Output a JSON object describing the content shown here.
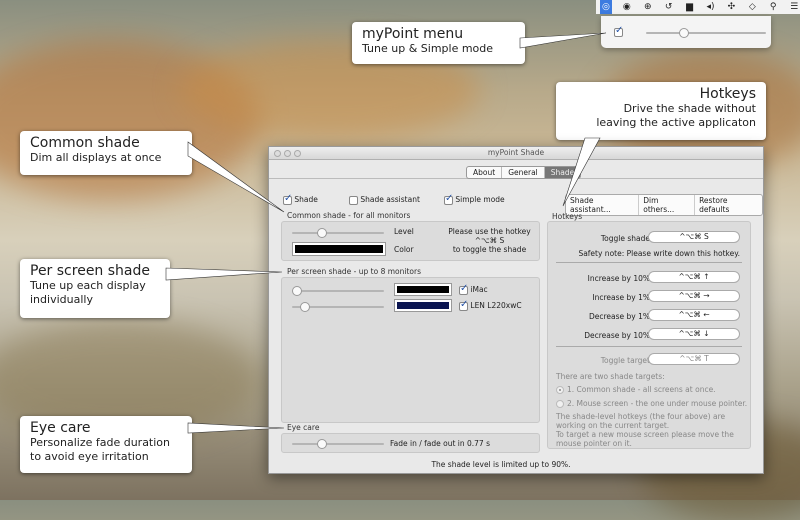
{
  "menubar": {
    "icons": [
      "mypoint-icon",
      "target-icon",
      "accessibility-icon",
      "time-machine-icon",
      "display-icon",
      "volume-icon",
      "move-icon",
      "wifi-icon",
      "spotlight-icon",
      "list-icon"
    ]
  },
  "popup": {
    "enabled": true,
    "level_pct": 30
  },
  "callouts": {
    "menu": {
      "title": "myPoint menu",
      "subtitle": "Tune up & Simple mode"
    },
    "hotkeys": {
      "title": "Hotkeys",
      "line1": "Drive the shade without",
      "line2": "leaving the active applicaton"
    },
    "common": {
      "title": "Common shade",
      "subtitle": "Dim all displays at once"
    },
    "perscreen": {
      "title": "Per screen shade",
      "line1": "Tune up each display",
      "line2": "individually"
    },
    "eyecare": {
      "title": "Eye care",
      "line1": "Personalize fade duration",
      "line2": "to avoid eye irritation"
    }
  },
  "window": {
    "title": "myPoint Shade",
    "tabs": [
      "About",
      "General",
      "Shade"
    ],
    "selected_tab": "Shade",
    "options": {
      "shade": "Shade",
      "shade_checked": true,
      "assistant": "Shade assistant",
      "assistant_checked": false,
      "simple": "Simple mode",
      "simple_checked": true
    },
    "buttons": [
      "Shade assistant...",
      "Dim others...",
      "Restore defaults"
    ],
    "common": {
      "label": "Common shade - for all monitors",
      "level": "Level",
      "color": "Color",
      "level_pct": 30,
      "color_hex": "#000000",
      "hint1": "Please use the hotkey",
      "hint2": "^⌥⌘ S",
      "hint3": "to toggle the shade"
    },
    "perscreen": {
      "label": "Per screen shade - up to 8 monitors",
      "monitors": [
        {
          "name": "iMac",
          "checked": true,
          "level_pct": 0,
          "color_hex": "#000000"
        },
        {
          "name": "LEN L220xwC",
          "checked": true,
          "level_pct": 10,
          "color_hex": "#0a1450"
        }
      ]
    },
    "eyecare": {
      "label": "Eye care",
      "text": "Fade in / fade out in 0.77 s",
      "level_pct": 30
    },
    "footer": "The shade level is limited up to 90%.",
    "hotkeys": {
      "label": "Hotkeys",
      "toggle_label": "Toggle shade",
      "toggle_key": "^⌥⌘ S",
      "safety": "Safety note: Please write down this hotkey.",
      "items": [
        {
          "label": "Increase by 10%",
          "key": "^⌥⌘ ↑"
        },
        {
          "label": "Increase by 1%",
          "key": "^⌥⌘ →"
        },
        {
          "label": "Decrease by 1%",
          "key": "^⌥⌘ ←"
        },
        {
          "label": "Decrease by 10%",
          "key": "^⌥⌘ ↓"
        }
      ],
      "target_label": "Toggle target",
      "target_key": "^⌥⌘ T",
      "targets_intro": "There are two shade targets:",
      "target1": "1. Common shade - all screens at once.",
      "target2": "2. Mouse screen - the one under mouse pointer.",
      "note1": "The shade-level hotkeys (the four above) are working on the current target.",
      "note2": "To target a new mouse screen please move the mouse pointer on it."
    }
  }
}
